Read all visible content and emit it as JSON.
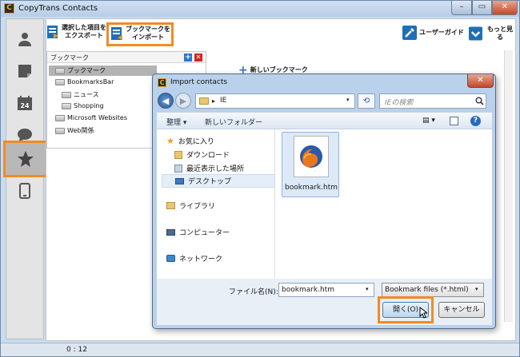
{
  "window": {
    "title": "CopyTrans Contacts",
    "min": "–",
    "max": "▭",
    "close": "✕"
  },
  "toolbar": {
    "export_label_1": "選択した項目を",
    "export_label_2": "エクスポート",
    "import_label_1": "ブックマークを",
    "import_label_2": "インポート",
    "guide_label": "ユーザーガイド",
    "more_label": "もっと見る"
  },
  "bookmarks": {
    "header": "ブックマーク",
    "new_bookmark": "新しいブックマーク",
    "tree": [
      {
        "label": "ブックマーク",
        "selected": true
      },
      {
        "label": "BookmarksBar"
      },
      {
        "label": "ニュース"
      },
      {
        "label": "Shopping"
      },
      {
        "label": "Microsoft Websites"
      },
      {
        "label": "Web関係"
      }
    ]
  },
  "status": {
    "time": "0 : 12"
  },
  "dialog": {
    "title": "Import contacts",
    "address_path": "IE",
    "search_placeholder": "IEの検索",
    "cmd_organize": "整理 ▾",
    "cmd_new_folder": "新しいフォルダー",
    "nav_items": [
      {
        "label": "お気に入り"
      },
      {
        "label": "ダウンロード"
      },
      {
        "label": "最近表示した場所"
      },
      {
        "label": "デスクトップ"
      },
      {
        "label": "ライブラリ"
      },
      {
        "label": "コンピューター"
      },
      {
        "label": "ネットワーク"
      }
    ],
    "file_name": "bookmark.htm",
    "filename_label": "ファイル名(N):",
    "filename_value": "bookmark.htm",
    "filetype_value": "Bookmark files (*.html)",
    "open_button": "開く(O)",
    "cancel_button": "キャンセル"
  },
  "colors": {
    "accent_orange": "#f28b22",
    "title_blue": "#b7cde6"
  }
}
